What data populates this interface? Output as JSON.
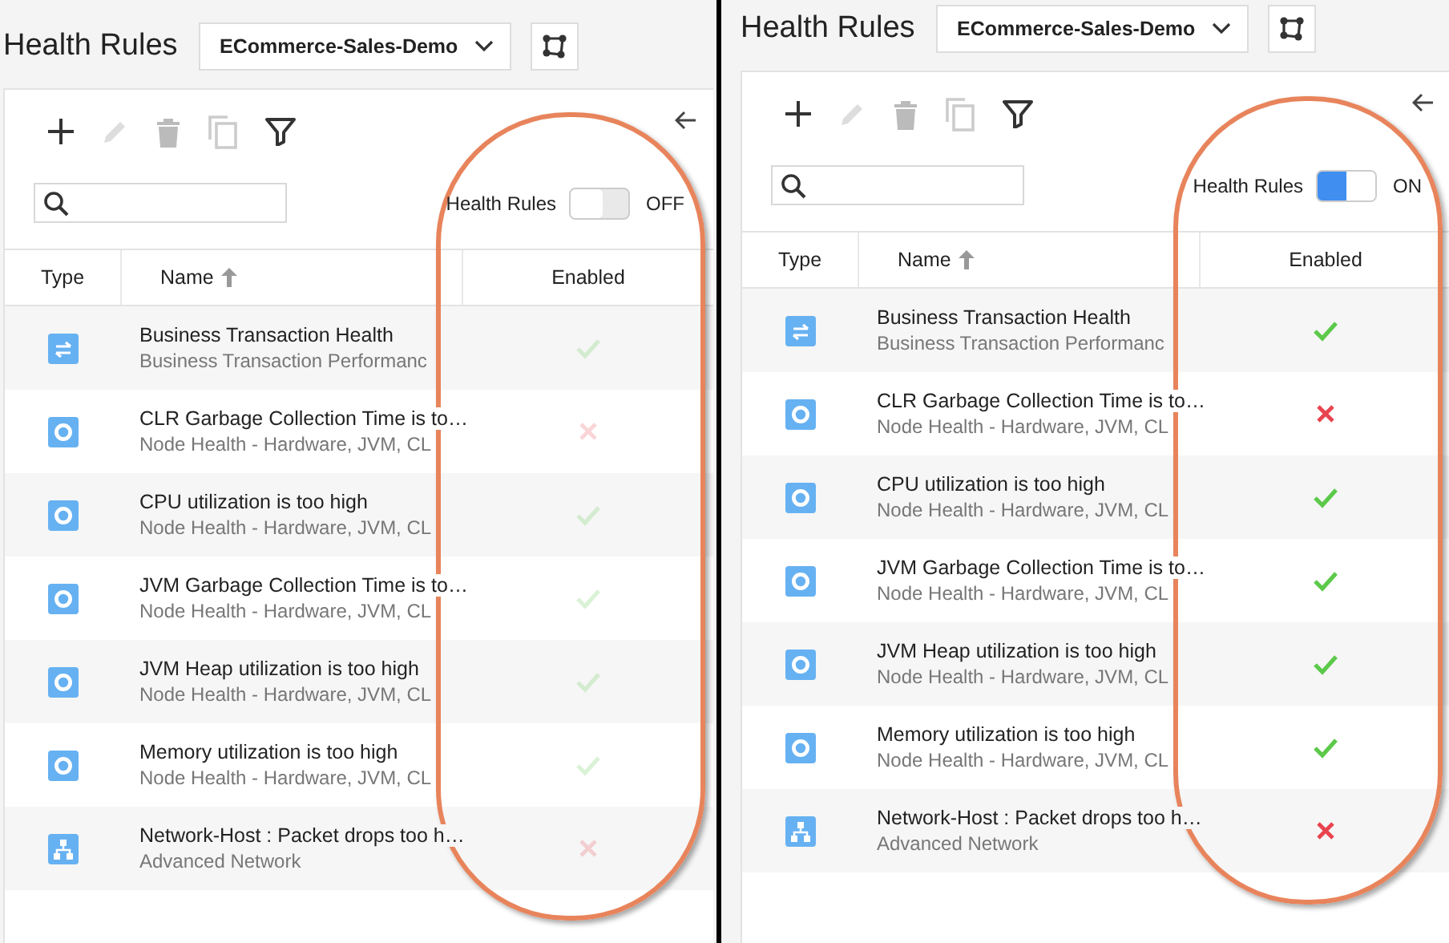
{
  "panels": [
    {
      "title": "Health Rules",
      "application": "ECommerce-Sales-Demo",
      "toolbar": [
        {
          "kind": "add",
          "disabled": false
        },
        {
          "kind": "edit",
          "disabled": true
        },
        {
          "kind": "delete",
          "disabled": true
        },
        {
          "kind": "copy",
          "disabled": true
        },
        {
          "kind": "filter",
          "disabled": false
        }
      ],
      "toggle": {
        "label": "Health Rules",
        "on": false,
        "state_text": "OFF"
      },
      "columns": [
        "Type",
        "Name",
        "Enabled"
      ],
      "rows": [
        {
          "kind": "transaction",
          "name": "Business Transaction Health",
          "subtitle": "Business Transaction Performanc",
          "enabled": true
        },
        {
          "kind": "node",
          "name": "CLR Garbage Collection Time is to…",
          "subtitle": "Node Health - Hardware, JVM, CL",
          "enabled": false
        },
        {
          "kind": "node",
          "name": "CPU utilization is too high",
          "subtitle": "Node Health - Hardware, JVM, CL",
          "enabled": true
        },
        {
          "kind": "node",
          "name": "JVM Garbage Collection Time is to…",
          "subtitle": "Node Health - Hardware, JVM, CL",
          "enabled": true
        },
        {
          "kind": "node",
          "name": "JVM Heap utilization is too high",
          "subtitle": "Node Health - Hardware, JVM, CL",
          "enabled": true
        },
        {
          "kind": "node",
          "name": "Memory utilization is too high",
          "subtitle": "Node Health - Hardware, JVM, CL",
          "enabled": true
        },
        {
          "kind": "network",
          "name": "Network-Host : Packet drops too h…",
          "subtitle": "Advanced Network",
          "enabled": false
        }
      ]
    },
    {
      "title": "Health Rules",
      "application": "ECommerce-Sales-Demo",
      "toolbar": [
        {
          "kind": "add",
          "disabled": false
        },
        {
          "kind": "edit",
          "disabled": true
        },
        {
          "kind": "delete",
          "disabled": true
        },
        {
          "kind": "copy",
          "disabled": true
        },
        {
          "kind": "filter",
          "disabled": false
        }
      ],
      "toggle": {
        "label": "Health Rules",
        "on": true,
        "state_text": "ON"
      },
      "columns": [
        "Type",
        "Name",
        "Enabled"
      ],
      "rows": [
        {
          "kind": "transaction",
          "name": "Business Transaction Health",
          "subtitle": "Business Transaction Performanc",
          "enabled": true
        },
        {
          "kind": "node",
          "name": "CLR Garbage Collection Time is to…",
          "subtitle": "Node Health - Hardware, JVM, CL",
          "enabled": false
        },
        {
          "kind": "node",
          "name": "CPU utilization is too high",
          "subtitle": "Node Health - Hardware, JVM, CL",
          "enabled": true
        },
        {
          "kind": "node",
          "name": "JVM Garbage Collection Time is to…",
          "subtitle": "Node Health - Hardware, JVM, CL",
          "enabled": true
        },
        {
          "kind": "node",
          "name": "JVM Heap utilization is too high",
          "subtitle": "Node Health - Hardware, JVM, CL",
          "enabled": true
        },
        {
          "kind": "node",
          "name": "Memory utilization is too high",
          "subtitle": "Node Health - Hardware, JVM, CL",
          "enabled": true
        },
        {
          "kind": "network",
          "name": "Network-Host : Packet drops too h…",
          "subtitle": "Advanced Network",
          "enabled": false
        }
      ]
    }
  ]
}
